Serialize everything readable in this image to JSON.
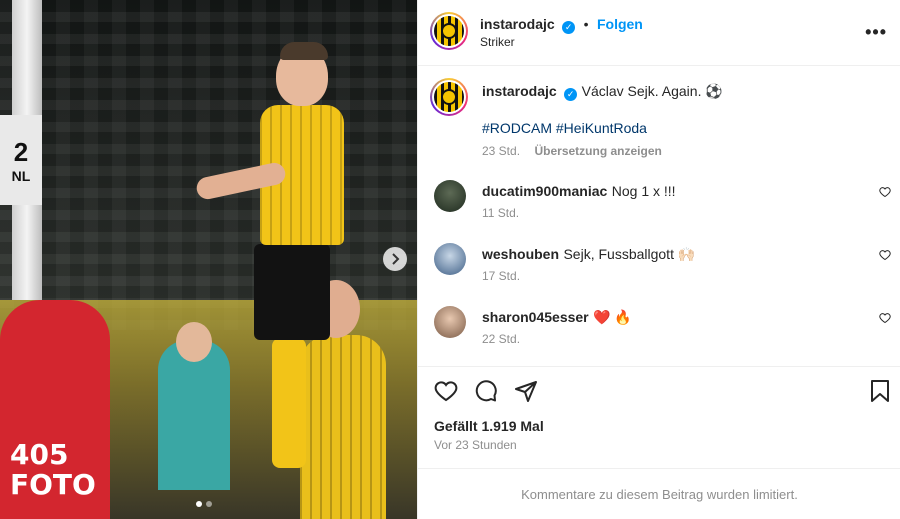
{
  "photo": {
    "sign_number": "2",
    "sign_text": "NL",
    "vest_text_1": "405",
    "vest_text_2": "FOTO",
    "next_arrow": "chevron-right-icon"
  },
  "header": {
    "username": "instarodajc",
    "follow_label": "Folgen",
    "subtitle": "Striker",
    "separator": "•"
  },
  "caption": {
    "username": "instarodajc",
    "text": "Václav Sejk. Again. ⚽",
    "hashtags": "#RODCAM #HeiKuntRoda",
    "time": "23 Std.",
    "translate": "Übersetzung anzeigen"
  },
  "comments": [
    {
      "username": "ducatim900maniac",
      "text": "Nog 1 x !!!",
      "time": "11 Std."
    },
    {
      "username": "weshouben",
      "text": "Sejk, Fussballgott 🙌🏻",
      "time": "17 Std."
    },
    {
      "username": "sharon045esser",
      "text": "❤️ 🔥",
      "time": "22 Std."
    }
  ],
  "post": {
    "likes": "Gefällt 1.919 Mal",
    "time_ago": "Vor 23 Stunden",
    "comments_limited": "Kommentare zu diesem Beitrag wurden limitiert."
  },
  "colors": {
    "accent_blue": "#0095f6",
    "text": "#262626",
    "muted": "#8e8e8e",
    "club_yellow": "#f5c400"
  }
}
